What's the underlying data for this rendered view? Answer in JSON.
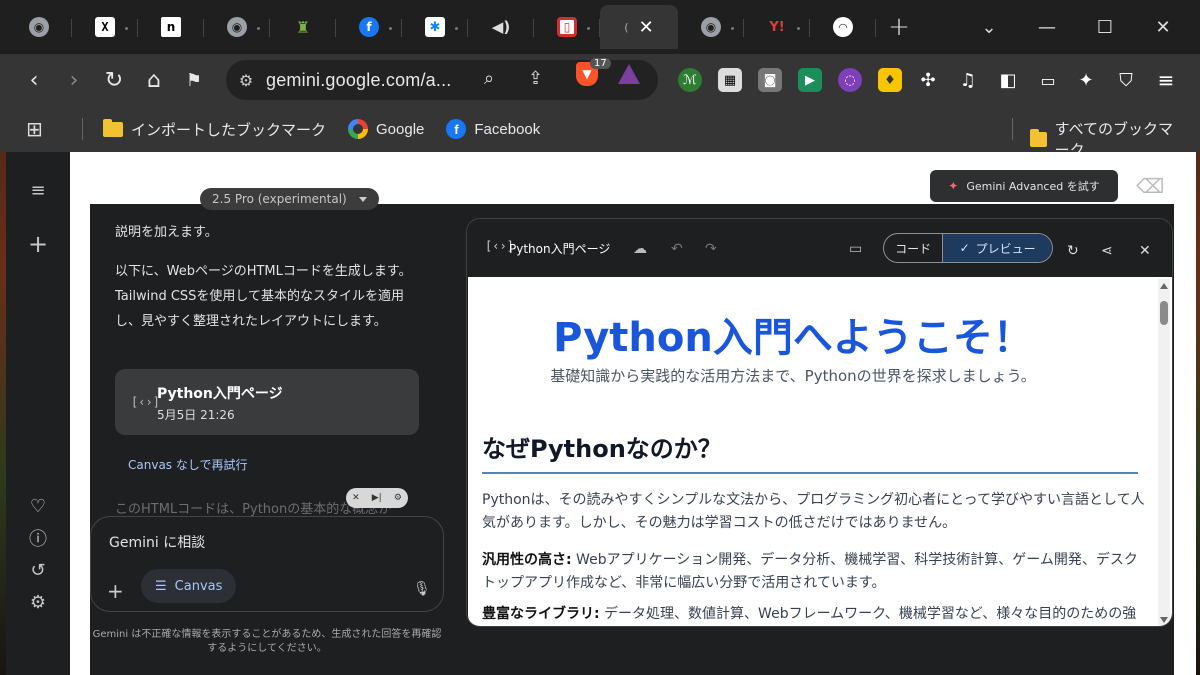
{
  "browser": {
    "tabs": [
      {
        "icon": "globe-icon",
        "glyph": "◉"
      },
      {
        "icon": "x-icon",
        "glyph": "X"
      },
      {
        "icon": "n-icon",
        "glyph": "n"
      },
      {
        "icon": "globe-icon",
        "glyph": "◉"
      },
      {
        "icon": "bottle-icon",
        "glyph": "♜"
      },
      {
        "icon": "facebook-icon",
        "glyph": "f"
      },
      {
        "icon": "bluesky-icon",
        "glyph": "✱"
      },
      {
        "icon": "speaker-icon",
        "glyph": "◀)"
      },
      {
        "icon": "red-square-icon",
        "glyph": "▯"
      }
    ],
    "after_tabs": [
      {
        "icon": "globe-icon",
        "glyph": "◉"
      },
      {
        "icon": "yahoo-icon",
        "glyph": "Y!"
      },
      {
        "icon": "rss-icon",
        "glyph": "◠"
      }
    ],
    "url": "gemini.google.com/a...",
    "brave_badge": "17",
    "new_tab": "+"
  },
  "bookmarks": {
    "imported": "インポートしたブックマーク",
    "google": "Google",
    "facebook": "Facebook",
    "all": "すべてのブックマーク"
  },
  "gemini": {
    "model": "2.5 Pro (experimental)",
    "advanced_btn": "Gemini Advanced を試す",
    "chat": {
      "line0": "説明を加えます。",
      "para1": "以下に、WebページのHTMLコードを生成します。Tailwind CSSを使用して基本的なスタイルを適用し、見やすく整理されたレイアウトにします。",
      "card_title": "Python入門ページ",
      "card_date": "5月5日 21:26",
      "retry": "Canvas なしで再試行",
      "faded": "このHTMLコードは、Pythonの基本的な概念か"
    },
    "input": {
      "placeholder": "Gemini に相談",
      "canvas_chip": "Canvas"
    },
    "disclaimer": "Gemini は不正確な情報を表示することがあるため、生成された回答を再確認するようにしてください。",
    "panel": {
      "title": "Python入門ページ",
      "code_tab": "コード",
      "preview_tab": "プレビュー"
    },
    "preview": {
      "h1": "Python入門へようこそ！",
      "subtitle": "基礎知識から実践的な活用方法まで、Pythonの世界を探求しましょう。",
      "h2": "なぜPythonなのか？",
      "p1": "Pythonは、その読みやすくシンプルな文法から、プログラミング初心者にとって学びやすい言語として人気があります。しかし、その魅力は学習コストの低さだけではありません。",
      "p2_bold": "汎用性の高さ:",
      "p2": " Webアプリケーション開発、データ分析、機械学習、科学技術計算、ゲーム開発、デスクトップアプリ作成など、非常に幅広い分野で活用されています。",
      "p3_bold": "豊富なライブラリ:",
      "p3": " データ処理、数値計算、Webフレームワーク、機械学習など、様々な目的のための強"
    }
  }
}
